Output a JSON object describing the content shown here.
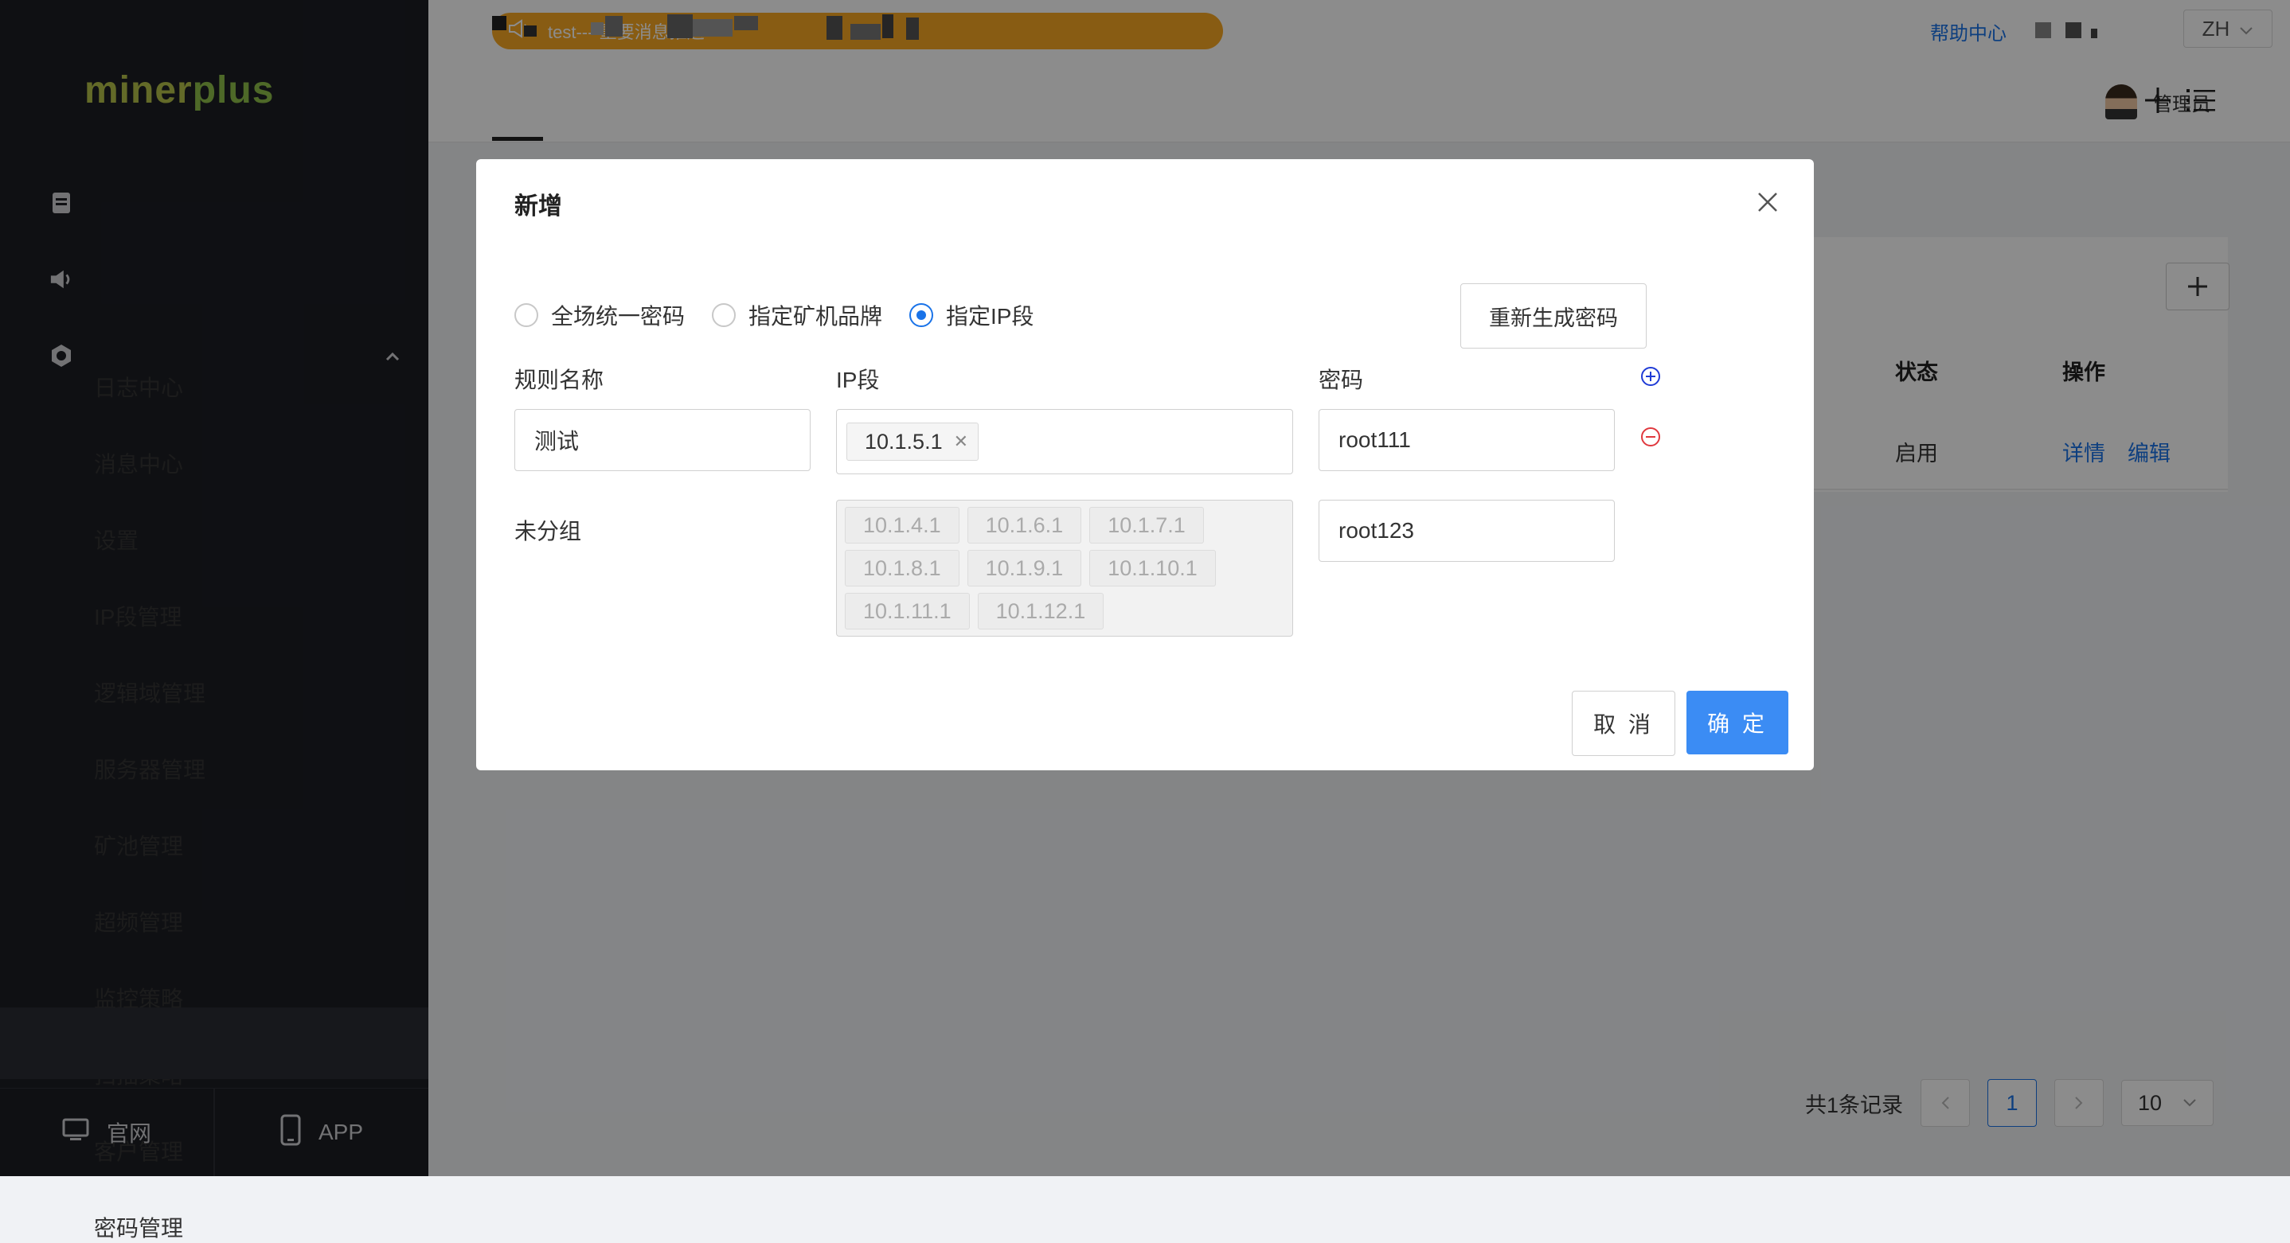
{
  "brand": {
    "part1": "miner",
    "part2": "plus"
  },
  "sidebar": {
    "items": [
      {
        "label": "日志中心",
        "icon": "log-icon"
      },
      {
        "label": "消息中心",
        "icon": "speaker-icon"
      },
      {
        "label": "设置",
        "icon": "settings-icon",
        "expanded": true
      }
    ],
    "sub_items": [
      {
        "label": "IP段管理"
      },
      {
        "label": "逻辑域管理"
      },
      {
        "label": "服务器管理"
      },
      {
        "label": "矿池管理"
      },
      {
        "label": "超频管理"
      },
      {
        "label": "监控策略"
      },
      {
        "label": "扫描策略"
      },
      {
        "label": "客户管理"
      },
      {
        "label": "密码管理",
        "active": true
      }
    ],
    "bottom": {
      "website_label": "官网",
      "app_label": "APP"
    }
  },
  "header": {
    "notice": "test----重要消息推送",
    "help": "帮助中心",
    "language": "ZH",
    "user": "管理员"
  },
  "table": {
    "columns": {
      "status": "状态",
      "actions": "操作"
    },
    "rows": [
      {
        "status": "启用",
        "detail": "详情",
        "edit": "编辑"
      }
    ]
  },
  "pagination": {
    "total": "共1条记录",
    "current_page": "1",
    "page_size": "10"
  },
  "modal": {
    "title": "新增",
    "radios": [
      {
        "label": "全场统一密码",
        "checked": false
      },
      {
        "label": "指定矿机品牌",
        "checked": false
      },
      {
        "label": "指定IP段",
        "checked": true
      }
    ],
    "regenerate_label": "重新生成密码",
    "labels": {
      "rule_name": "规则名称",
      "ip_segment": "IP段",
      "password": "密码",
      "ungrouped": "未分组"
    },
    "rule_name_value": "测试",
    "selected_ips": [
      "10.1.5.1"
    ],
    "password_value": "root111",
    "ungrouped_ips": [
      "10.1.4.1",
      "10.1.6.1",
      "10.1.7.1",
      "10.1.8.1",
      "10.1.9.1",
      "10.1.10.1",
      "10.1.11.1",
      "10.1.12.1"
    ],
    "ungrouped_password": "root123",
    "cancel_label": "取 消",
    "ok_label": "确 定"
  },
  "colors": {
    "primary": "#3b8cf4",
    "notice": "#f7a823",
    "sidebar": "#1c1e24",
    "danger": "#e0383e",
    "add": "#1f3bd6"
  }
}
